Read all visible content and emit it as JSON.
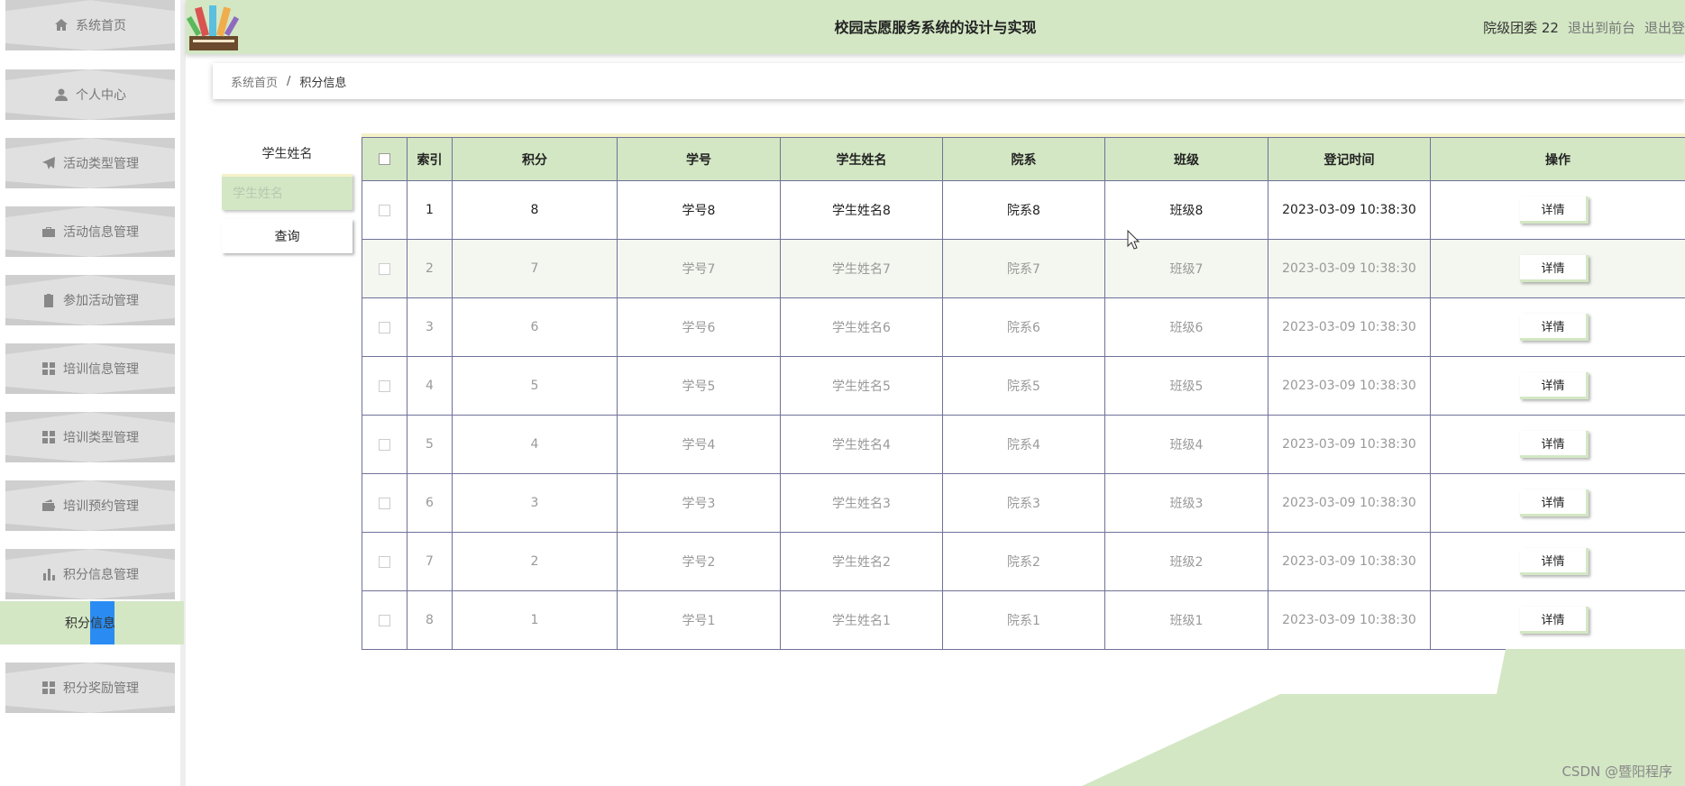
{
  "header": {
    "title": "校园志愿服务系统的设计与实现",
    "user": "院级团委 22",
    "links": [
      "退出到前台",
      "退出登"
    ]
  },
  "sidebar": {
    "items": [
      {
        "label": "系统首页",
        "icon": "home-icon"
      },
      {
        "label": "个人中心",
        "icon": "user-icon"
      },
      {
        "label": "活动类型管理",
        "icon": "paper-plane-icon"
      },
      {
        "label": "活动信息管理",
        "icon": "briefcase-icon"
      },
      {
        "label": "参加活动管理",
        "icon": "clipboard-icon"
      },
      {
        "label": "培训信息管理",
        "icon": "grid-icon"
      },
      {
        "label": "培训类型管理",
        "icon": "grid-icon"
      },
      {
        "label": "培训预约管理",
        "icon": "wallet-icon"
      },
      {
        "label": "积分信息管理",
        "icon": "bar-chart-icon"
      },
      {
        "label": "积分奖励管理",
        "icon": "grid-icon"
      }
    ],
    "submenu": {
      "label_a": "积分",
      "label_b": "信息"
    }
  },
  "breadcrumb": {
    "home": "系统首页",
    "separator": "/",
    "current": "积分信息"
  },
  "search": {
    "label": "学生姓名",
    "placeholder": "学生姓名",
    "button": "查询"
  },
  "table": {
    "headers": [
      "索引",
      "积分",
      "学号",
      "学生姓名",
      "院系",
      "班级",
      "登记时间",
      "操作"
    ],
    "action_label": "详情",
    "rows": [
      {
        "index": "1",
        "points": "8",
        "student_no": "学号8",
        "name": "学生姓名8",
        "dept": "院系8",
        "class": "班级8",
        "time": "2023-03-09 10:38:30"
      },
      {
        "index": "2",
        "points": "7",
        "student_no": "学号7",
        "name": "学生姓名7",
        "dept": "院系7",
        "class": "班级7",
        "time": "2023-03-09 10:38:30"
      },
      {
        "index": "3",
        "points": "6",
        "student_no": "学号6",
        "name": "学生姓名6",
        "dept": "院系6",
        "class": "班级6",
        "time": "2023-03-09 10:38:30"
      },
      {
        "index": "4",
        "points": "5",
        "student_no": "学号5",
        "name": "学生姓名5",
        "dept": "院系5",
        "class": "班级5",
        "time": "2023-03-09 10:38:30"
      },
      {
        "index": "5",
        "points": "4",
        "student_no": "学号4",
        "name": "学生姓名4",
        "dept": "院系4",
        "class": "班级4",
        "time": "2023-03-09 10:38:30"
      },
      {
        "index": "6",
        "points": "3",
        "student_no": "学号3",
        "name": "学生姓名3",
        "dept": "院系3",
        "class": "班级3",
        "time": "2023-03-09 10:38:30"
      },
      {
        "index": "7",
        "points": "2",
        "student_no": "学号2",
        "name": "学生姓名2",
        "dept": "院系2",
        "class": "班级2",
        "time": "2023-03-09 10:38:30"
      },
      {
        "index": "8",
        "points": "1",
        "student_no": "学号1",
        "name": "学生姓名1",
        "dept": "院系1",
        "class": "班级1",
        "time": "2023-03-09 10:38:30"
      }
    ]
  },
  "watermark": "CSDN @暨阳程序",
  "colors": {
    "accent": "#d3e7c4",
    "highlight": "#2a8cf2",
    "border": "#6f7298",
    "stripe": "#f5f1c8"
  }
}
